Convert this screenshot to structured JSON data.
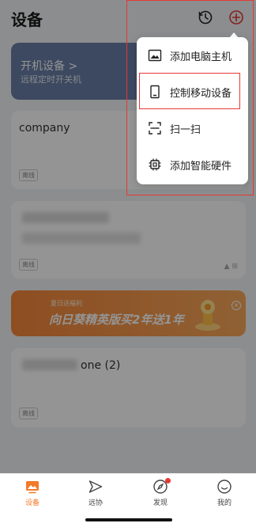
{
  "header": {
    "title": "设备",
    "history_icon": "history-icon",
    "add_icon": "add-circle-icon"
  },
  "power_card": {
    "title": "开机设备 >",
    "subtitle": "远程定时开关机"
  },
  "devices": [
    {
      "name": "company",
      "status": "离线"
    },
    {
      "name": "",
      "status": "离线"
    },
    {
      "name": "one (2)",
      "status": "离线"
    }
  ],
  "banner": {
    "tag": "夏日送福利",
    "text": "向日葵精英版买2年送1年",
    "close": "×"
  },
  "menu": {
    "items": [
      {
        "label": "添加电脑主机",
        "icon": "image-monitor-icon"
      },
      {
        "label": "控制移动设备",
        "icon": "phone-icon"
      },
      {
        "label": "扫一扫",
        "icon": "scan-icon"
      },
      {
        "label": "添加智能硬件",
        "icon": "chip-icon"
      }
    ]
  },
  "tabbar": {
    "items": [
      {
        "label": "设备",
        "icon": "devices-icon",
        "active": true
      },
      {
        "label": "远协",
        "icon": "remote-assist-icon"
      },
      {
        "label": "发现",
        "icon": "compass-icon",
        "badge": true
      },
      {
        "label": "我的",
        "icon": "profile-icon"
      }
    ]
  },
  "colors": {
    "accent": "#f47a2a",
    "annotation": "#e53935",
    "power_card": "#6a7fa6"
  }
}
